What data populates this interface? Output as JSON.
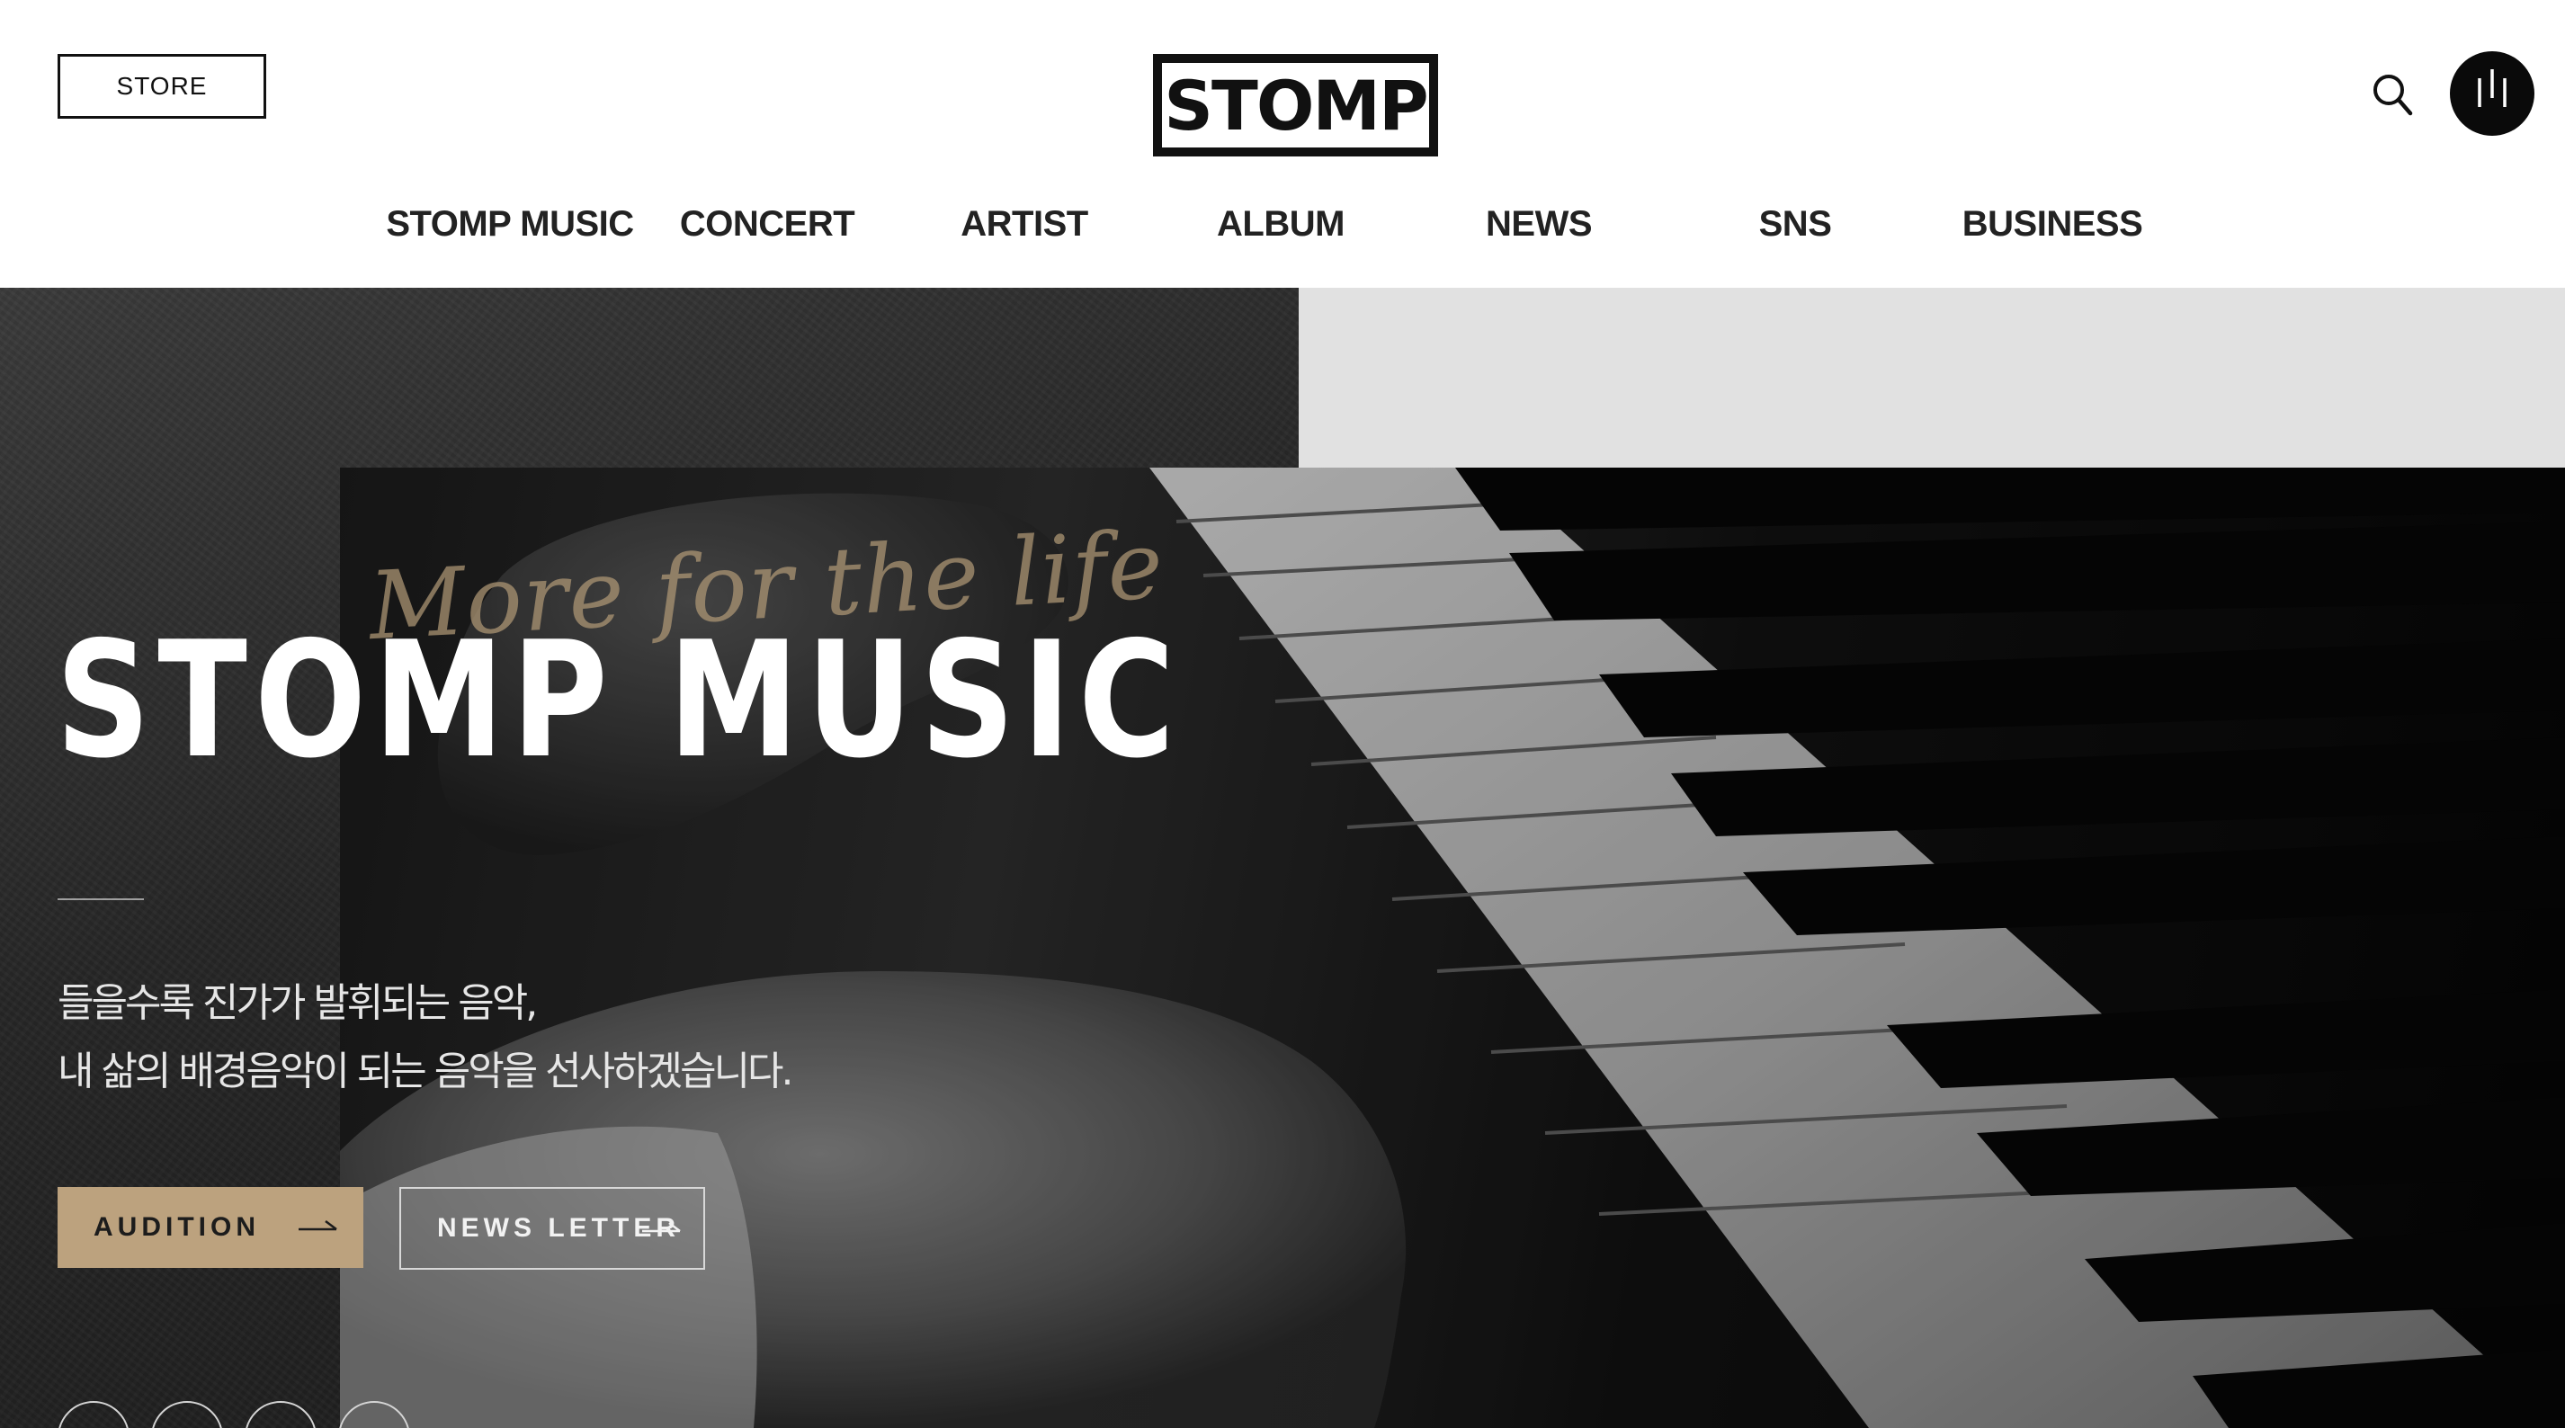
{
  "header": {
    "store_label": "STORE",
    "logo_text": "STOMP",
    "nav": [
      {
        "label": "STOMP MUSIC"
      },
      {
        "label": "CONCERT"
      },
      {
        "label": "ARTIST"
      },
      {
        "label": "ALBUM"
      },
      {
        "label": "NEWS"
      },
      {
        "label": "SNS"
      },
      {
        "label": "BUSINESS"
      }
    ],
    "icons": {
      "search": "search-icon",
      "menu": "menu-bars-icon"
    }
  },
  "hero": {
    "script_text": "More for the life",
    "title": "STOMP MUSIC",
    "description": [
      "들을수록 진가가 발휘되는 음악,",
      "내 삶의 배경음악이 되는 음악을 선사하겠습니다."
    ],
    "buttons": {
      "audition": "AUDITION",
      "newsletter": "NEWS LETTER"
    },
    "social_icons": [
      "instagram-icon",
      "youtube-icon",
      "facebook-icon",
      "blog-icon"
    ]
  },
  "colors": {
    "accent_gold": "#bca27e",
    "text_dark": "#111111",
    "hero_bg": "#121212",
    "grey_panel": "#e1e1e1"
  }
}
